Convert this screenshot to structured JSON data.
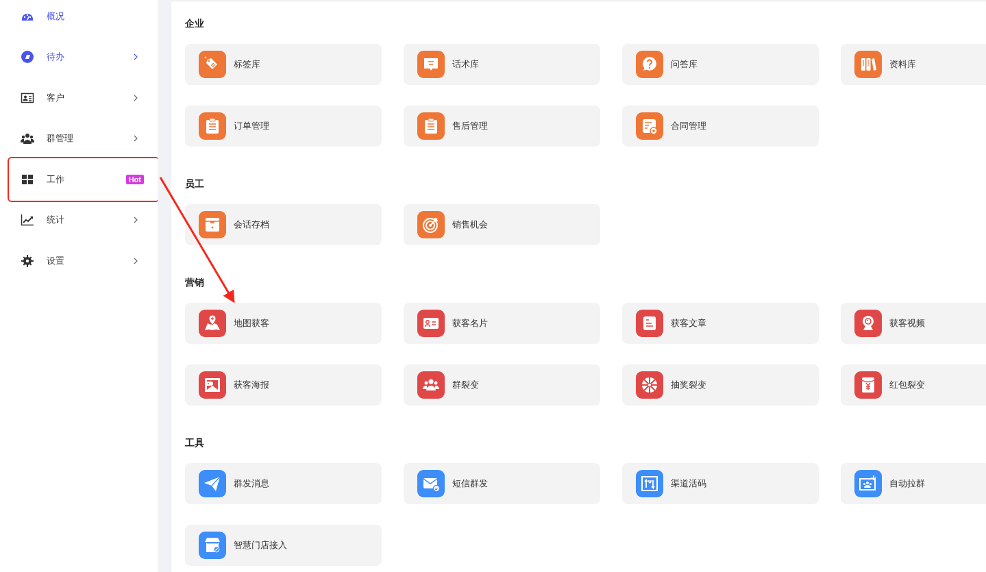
{
  "sidebar": {
    "items": [
      {
        "label": "概况",
        "kind": "gauge",
        "active": true,
        "submenu": false,
        "highlighted": false
      },
      {
        "label": "待办",
        "kind": "disc",
        "active": true,
        "submenu": true,
        "highlighted": false
      },
      {
        "label": "客户",
        "kind": "idcard",
        "active": false,
        "submenu": true,
        "highlighted": false
      },
      {
        "label": "群管理",
        "kind": "people",
        "active": false,
        "submenu": true,
        "highlighted": false
      },
      {
        "label": "工作",
        "kind": "grid",
        "active": false,
        "submenu": false,
        "highlighted": true,
        "badge": "Hot"
      },
      {
        "label": "统计",
        "kind": "chart",
        "active": false,
        "submenu": true,
        "highlighted": false
      },
      {
        "label": "设置",
        "kind": "gear",
        "active": false,
        "submenu": true,
        "highlighted": false
      }
    ]
  },
  "sections": [
    {
      "title": "企业",
      "color": "#ee7738",
      "cards": [
        {
          "label": "标签库",
          "kind": "tag"
        },
        {
          "label": "话术库",
          "kind": "chat"
        },
        {
          "label": "问答库",
          "kind": "question"
        },
        {
          "label": "资料库",
          "kind": "books"
        },
        {
          "label": "订单管理",
          "kind": "clipboard"
        },
        {
          "label": "售后管理",
          "kind": "clipboard"
        },
        {
          "label": "合同管理",
          "kind": "contract"
        }
      ]
    },
    {
      "title": "员工",
      "color": "#ee7738",
      "cards": [
        {
          "label": "会话存档",
          "kind": "archive"
        },
        {
          "label": "销售机会",
          "kind": "target"
        }
      ]
    },
    {
      "title": "营销",
      "color": "#e04848",
      "cards": [
        {
          "label": "地图获客",
          "kind": "map"
        },
        {
          "label": "获客名片",
          "kind": "card"
        },
        {
          "label": "获客文章",
          "kind": "doc"
        },
        {
          "label": "获客视频",
          "kind": "webcam"
        },
        {
          "label": "获客海报",
          "kind": "picture"
        },
        {
          "label": "群裂变",
          "kind": "group"
        },
        {
          "label": "抽奖裂变",
          "kind": "wheel"
        },
        {
          "label": "红包裂变",
          "kind": "envelope"
        }
      ]
    },
    {
      "title": "工具",
      "color": "#3d8ef8",
      "cards": [
        {
          "label": "群发消息",
          "kind": "plane"
        },
        {
          "label": "短信群发",
          "kind": "mail"
        },
        {
          "label": "渠道活码",
          "kind": "channel"
        },
        {
          "label": "自动拉群",
          "kind": "screen"
        },
        {
          "label": "智慧门店接入",
          "kind": "store"
        }
      ]
    }
  ]
}
